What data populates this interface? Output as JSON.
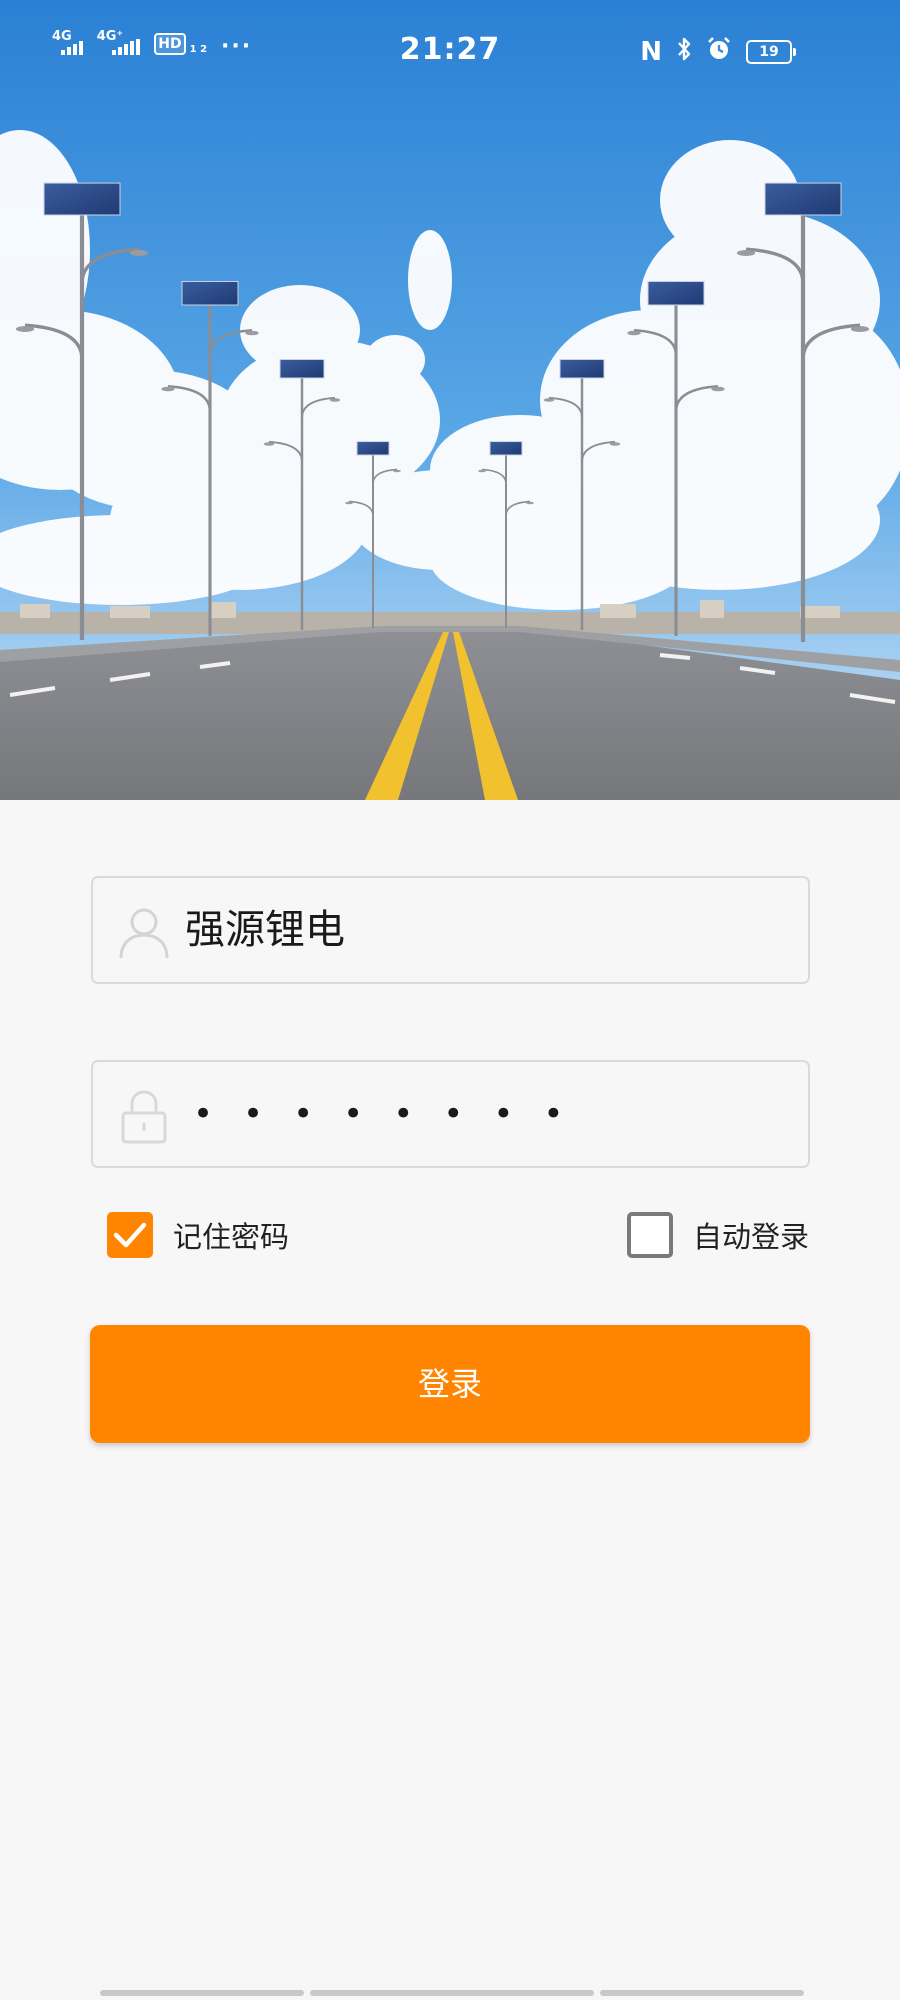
{
  "status_bar": {
    "time": "21:27",
    "network_1": "4G",
    "network_2": "4G⁺",
    "hd_badge": "HD",
    "hd_sub": "1 2",
    "more": "···",
    "nfc_icon": "N",
    "bluetooth_icon": "bluetooth-icon",
    "alarm_icon": "alarm-icon",
    "battery": "19"
  },
  "login_form": {
    "username": "强源锂电",
    "password_mask": "••••••••",
    "remember_password": {
      "label": "记住密码",
      "checked": true
    },
    "auto_login": {
      "label": "自动登录",
      "checked": false
    },
    "submit_label": "登录"
  },
  "colors": {
    "accent": "#ff8400",
    "background": "#f7f7f7",
    "sky": "#3a8fd8"
  },
  "icons": {
    "username": "user-icon",
    "password": "lock-icon",
    "check": "checkmark-icon"
  }
}
